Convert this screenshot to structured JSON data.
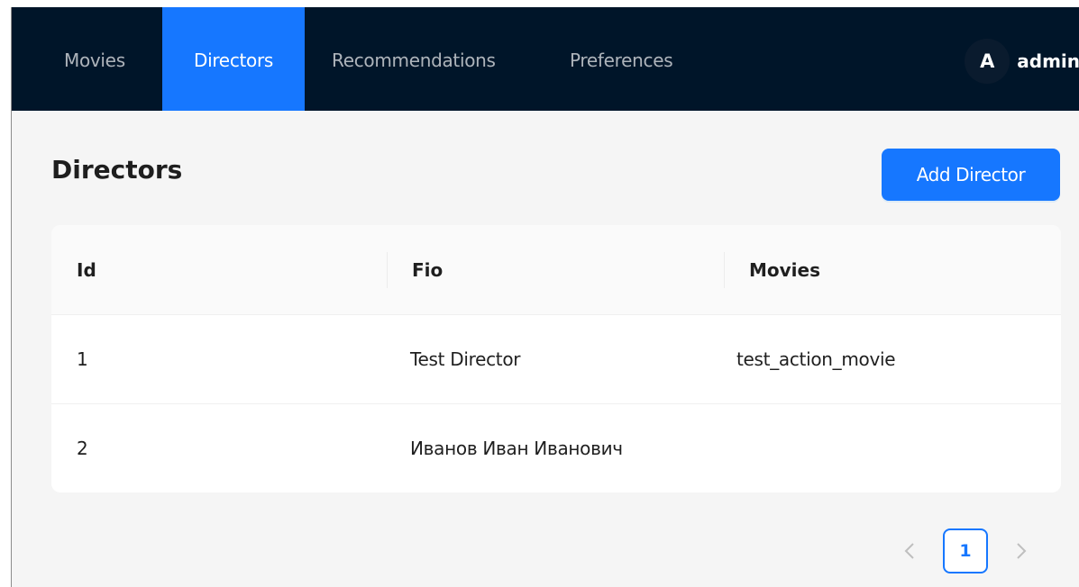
{
  "nav": {
    "items": [
      {
        "label": "Movies"
      },
      {
        "label": "Directors"
      },
      {
        "label": "Recommendations"
      },
      {
        "label": "Preferences"
      }
    ],
    "active": "Directors"
  },
  "user": {
    "avatar_initial": "A",
    "name": "admin"
  },
  "page": {
    "title": "Directors",
    "add_button_label": "Add Director"
  },
  "table": {
    "columns": [
      "Id",
      "Fio",
      "Movies"
    ],
    "rows": [
      {
        "id": "1",
        "fio": "Test Director",
        "movies": "test_action_movie"
      },
      {
        "id": "2",
        "fio": "Иванов Иван Иванович",
        "movies": ""
      }
    ]
  },
  "pagination": {
    "prev_icon": "chevron-left-icon",
    "next_icon": "chevron-right-icon",
    "current_page": "1"
  },
  "colors": {
    "nav_background": "#001529",
    "accent": "#1677ff",
    "page_background": "#f5f5f5"
  }
}
